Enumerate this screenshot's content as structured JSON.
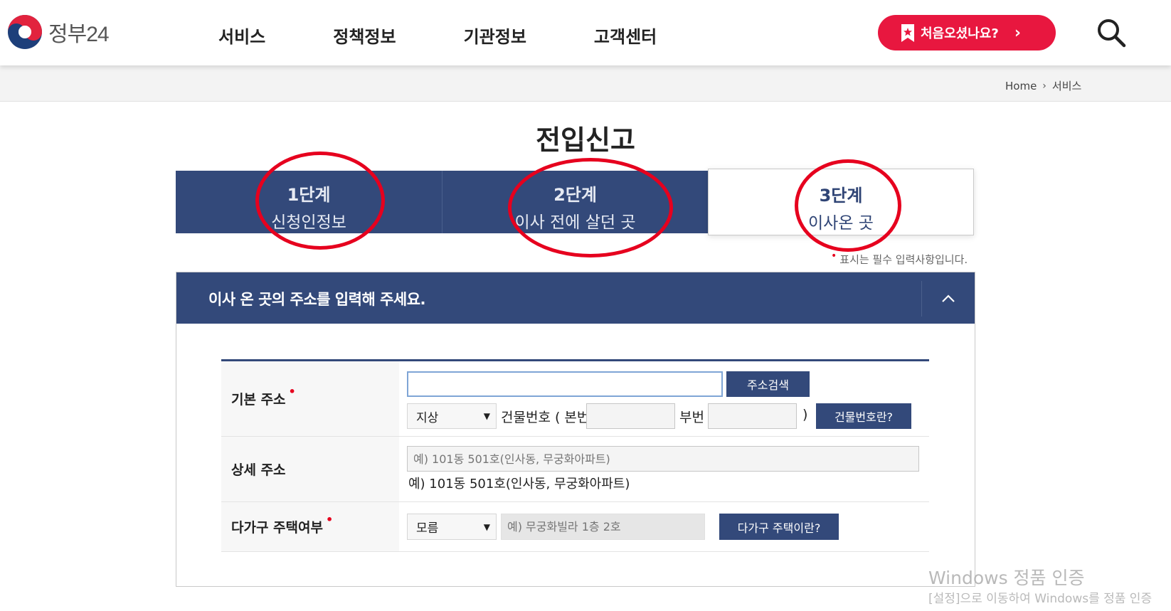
{
  "header": {
    "logo_text": "정부24",
    "nav": [
      "서비스",
      "정책정보",
      "기관정보",
      "고객센터"
    ],
    "first_visit_label": "처음오셨나요?",
    "first_visit_chevron": "›"
  },
  "breadcrumb": {
    "home": "Home",
    "separator": "›",
    "current": "서비스"
  },
  "page_title": "전입신고",
  "steps": [
    {
      "num": "1단계",
      "name": "신청인정보"
    },
    {
      "num": "2단계",
      "name": "이사 전에 살던 곳"
    },
    {
      "num": "3단계",
      "name": "이사온 곳"
    }
  ],
  "required_note": "표시는 필수 입력사항입니다.",
  "required_mark": "•",
  "section": {
    "title": "이사 온 곳의 주소를 입력해 주세요.",
    "rows": {
      "basic": {
        "label": "기본 주소",
        "address_value": "",
        "search_button": "주소검색",
        "ground_select": "지상",
        "building_no_label": "건물번호 ( 본번",
        "sub_no_label": "부번",
        "close_paren": ")",
        "building_help_button": "건물번호란?"
      },
      "detail": {
        "label": "상세 주소",
        "placeholder": "예) 101동 501호(인사동, 무궁화아파트)",
        "example": "예) 101동 501호(인사동, 무궁화아파트)"
      },
      "multi": {
        "label": "다가구 주택여부",
        "select_value": "모름",
        "placeholder": "예) 무궁화빌라 1층 2호",
        "help_button": "다가구 주택이란?"
      }
    }
  },
  "watermark": {
    "line1": "Windows 정품 인증",
    "line2": "[설정]으로 이동하여 Windows를 정품 인증"
  },
  "colors": {
    "navy": "#33497a",
    "red": "#e8173f",
    "annotation_red": "#e6001e"
  }
}
